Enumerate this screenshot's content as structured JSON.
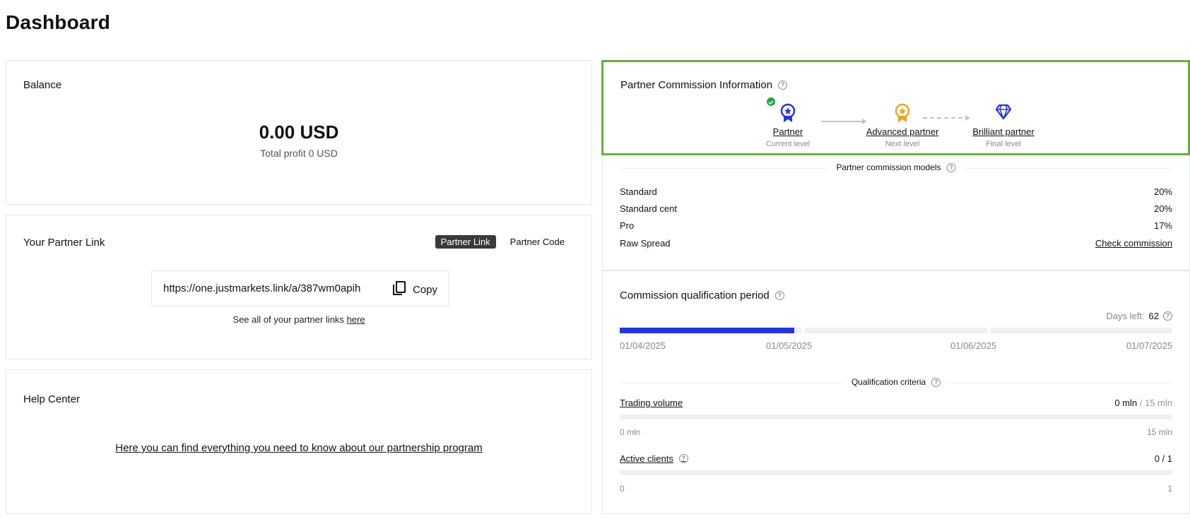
{
  "page": {
    "title": "Dashboard"
  },
  "balance": {
    "title": "Balance",
    "amount": "0.00 USD",
    "total_profit": "Total profit 0 USD"
  },
  "partner_link": {
    "title": "Your Partner Link",
    "toggles": [
      {
        "label": "Partner Link",
        "active": true
      },
      {
        "label": "Partner Code",
        "active": false
      }
    ],
    "url": "https://one.justmarkets.link/a/387wm0apih",
    "copy_label": "Copy",
    "all_links_text": "See all of your partner links",
    "all_links_anchor": "here"
  },
  "help_center": {
    "title": "Help Center",
    "link_text": "Here you can find everything you need to know about our partnership program"
  },
  "commission": {
    "title": "Partner Commission Information",
    "levels": [
      {
        "name": "Partner",
        "sub": "Current level",
        "icon": "medal-icon",
        "color": "#2533e8",
        "achieved": true
      },
      {
        "name": "Advanced partner",
        "sub": "Next level",
        "icon": "medal-icon",
        "color": "#e3a81f",
        "achieved": false
      },
      {
        "name": "Brilliant partner",
        "sub": "Final level",
        "icon": "diamond-icon",
        "color": "#2533e8",
        "achieved": false
      }
    ],
    "models_title": "Partner commission models",
    "models": [
      {
        "name": "Standard",
        "value": "20%"
      },
      {
        "name": "Standard cent",
        "value": "20%"
      },
      {
        "name": "Pro",
        "value": "17%"
      },
      {
        "name": "Raw Spread",
        "value": "Check commission"
      }
    ]
  },
  "qualification": {
    "title": "Commission qualification period",
    "days_left_label": "Days left:",
    "days_left_value": "62",
    "progress_fraction": 0.32,
    "dates": [
      "01/04/2025",
      "01/05/2025",
      "01/06/2025",
      "01/07/2025"
    ],
    "criteria_title": "Qualification criteria",
    "criteria": [
      {
        "label": "Trading volume",
        "current": "0 mln",
        "total": "/ 15 mln",
        "min": "0 mln",
        "max": "15 mln",
        "progress": 0,
        "help": false
      },
      {
        "label": "Active clients",
        "current": "0 / 1",
        "total": "",
        "min": "0",
        "max": "1",
        "progress": 0,
        "help": true
      }
    ]
  },
  "colors": {
    "accent_blue": "#2533e8",
    "gold": "#e3a81f",
    "highlight_green": "#6aad3f",
    "success_green": "#22a447"
  }
}
